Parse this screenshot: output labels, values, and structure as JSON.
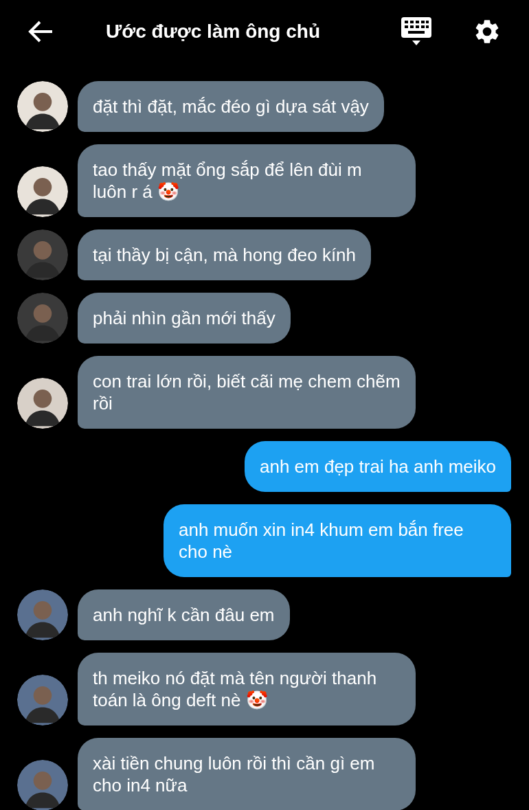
{
  "header": {
    "title": "Ước được làm ông chủ"
  },
  "messages": [
    {
      "kind": "incoming",
      "color": "#e8e2da",
      "text": "đặt thì đặt, mắc đéo gì dựa sát vậy"
    },
    {
      "kind": "incoming",
      "color": "#e8e2da",
      "text": "tao thấy mặt ổng sắp để lên đùi m luôn r á 🤡"
    },
    {
      "kind": "incoming",
      "color": "#3a3a3a",
      "text": "tại thầy bị cận, mà hong đeo kính"
    },
    {
      "kind": "incoming",
      "color": "#3a3a3a",
      "text": "phải nhìn gần mới thấy"
    },
    {
      "kind": "incoming",
      "color": "#d8d0c8",
      "text": "con trai lớn rồi, biết cãi mẹ chem chẽm rồi"
    },
    {
      "kind": "outgoing",
      "text": "anh em đẹp trai ha anh meiko"
    },
    {
      "kind": "outgoing",
      "text": "anh muốn xin in4 khum em bắn free cho nè"
    },
    {
      "kind": "incoming",
      "color": "#5a7090",
      "text": "anh nghĩ k cần đâu em"
    },
    {
      "kind": "incoming",
      "color": "#5a7090",
      "text": "th meiko nó đặt mà tên người thanh toán là ông deft nè 🤡"
    },
    {
      "kind": "incoming",
      "color": "#5a7090",
      "text": "xài tiền chung luôn rồi thì cần gì em cho in4 nữa"
    }
  ]
}
